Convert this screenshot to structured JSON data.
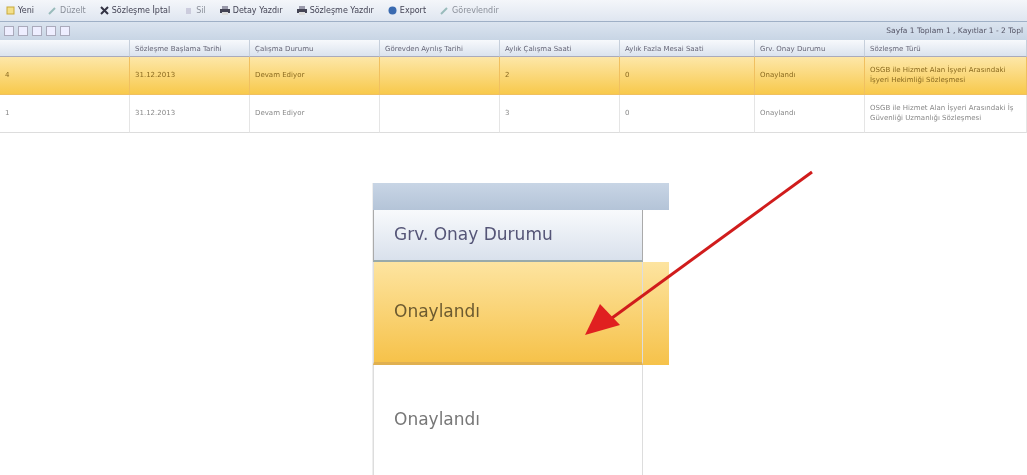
{
  "toolbar": [
    {
      "kind": "new",
      "label": "Yeni",
      "disabled": false
    },
    {
      "kind": "edit",
      "label": "Düzelt",
      "disabled": true
    },
    {
      "kind": "cancel",
      "label": "Sözleşme İptal",
      "disabled": false
    },
    {
      "kind": "delete",
      "label": "Sil",
      "disabled": true
    },
    {
      "kind": "print",
      "label": "Detay Yazdır",
      "disabled": false
    },
    {
      "kind": "print",
      "label": "Sözleşme Yazdır",
      "disabled": false
    },
    {
      "kind": "export",
      "label": "Export",
      "disabled": false
    },
    {
      "kind": "edit",
      "label": "Görevlendir",
      "disabled": true
    }
  ],
  "pager": {
    "summary": "Sayfa 1 Toplam 1 , Kayıtlar 1 - 2 Topl"
  },
  "table": {
    "columns": [
      "",
      "Sözleşme Başlama Tarihi",
      "Çalışma Durumu",
      "Görevden Ayrılış Tarihi",
      "Aylık Çalışma Saati",
      "Aylık Fazla Mesai Saati",
      "Grv. Onay Durumu",
      "Sözleşme Türü"
    ],
    "rows": [
      {
        "selected": true,
        "cells": [
          "4",
          "31.12.2013",
          "Devam Ediyor",
          "",
          "2",
          "0",
          "Onaylandı",
          "OSGB ile Hizmet Alan İşyeri Arasındaki İşyeri Hekimliği Sözleşmesi"
        ]
      },
      {
        "selected": false,
        "cells": [
          "1",
          "31.12.2013",
          "Devam Ediyor",
          "",
          "3",
          "0",
          "Onaylandı",
          "OSGB ile Hizmet Alan İşyeri Arasındaki İş Güvenliği Uzmanlığı Sözleşmesi"
        ]
      }
    ]
  },
  "zoom_inset": {
    "column": "Grv. Onay Durumu",
    "rows": [
      {
        "selected": true,
        "value": "Onaylandı"
      },
      {
        "selected": false,
        "value": "Onaylandı"
      }
    ]
  }
}
